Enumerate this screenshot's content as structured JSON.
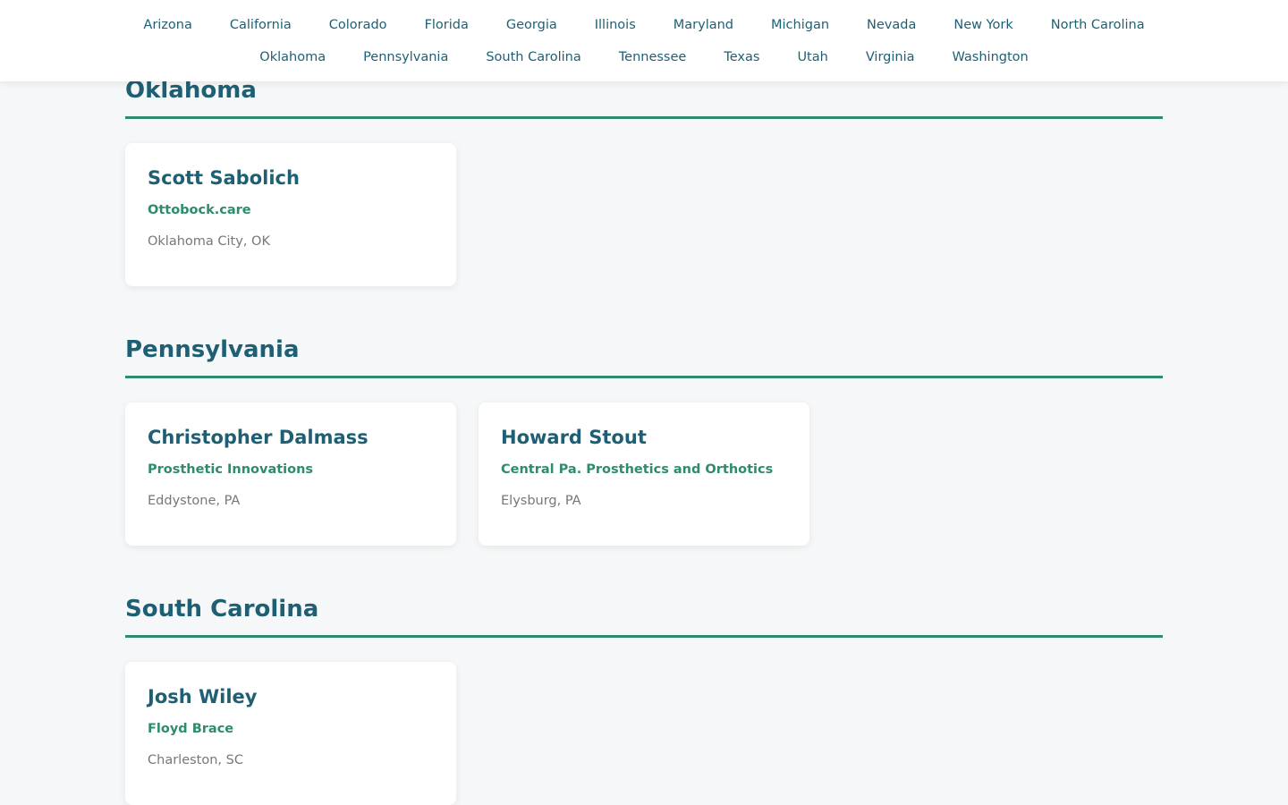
{
  "nav": {
    "row1": [
      "Arizona",
      "California",
      "Colorado",
      "Florida",
      "Georgia",
      "Illinois",
      "Maryland",
      "Michigan",
      "Nevada",
      "New York",
      "North Carolina"
    ],
    "row2": [
      "Oklahoma",
      "Pennsylvania",
      "South Carolina",
      "Tennessee",
      "Texas",
      "Utah",
      "Virginia",
      "Washington"
    ]
  },
  "sections": [
    {
      "title": "Oklahoma",
      "cards": [
        {
          "name": "Scott Sabolich",
          "company": "Ottobock.care",
          "location": "Oklahoma City, OK"
        }
      ]
    },
    {
      "title": "Pennsylvania",
      "cards": [
        {
          "name": "Christopher Dalmass",
          "company": "Prosthetic Innovations",
          "location": "Eddystone, PA"
        },
        {
          "name": "Howard Stout",
          "company": "Central Pa. Prosthetics and Orthotics",
          "location": "Elysburg, PA"
        }
      ]
    },
    {
      "title": "South Carolina",
      "cards": [
        {
          "name": "Josh Wiley",
          "company": "Floyd Brace",
          "location": "Charleston, SC"
        }
      ]
    }
  ],
  "colors": {
    "heading": "#1f5f74",
    "accent": "#2e8b6e",
    "muted": "#777777",
    "background": "#f5f7f8"
  }
}
